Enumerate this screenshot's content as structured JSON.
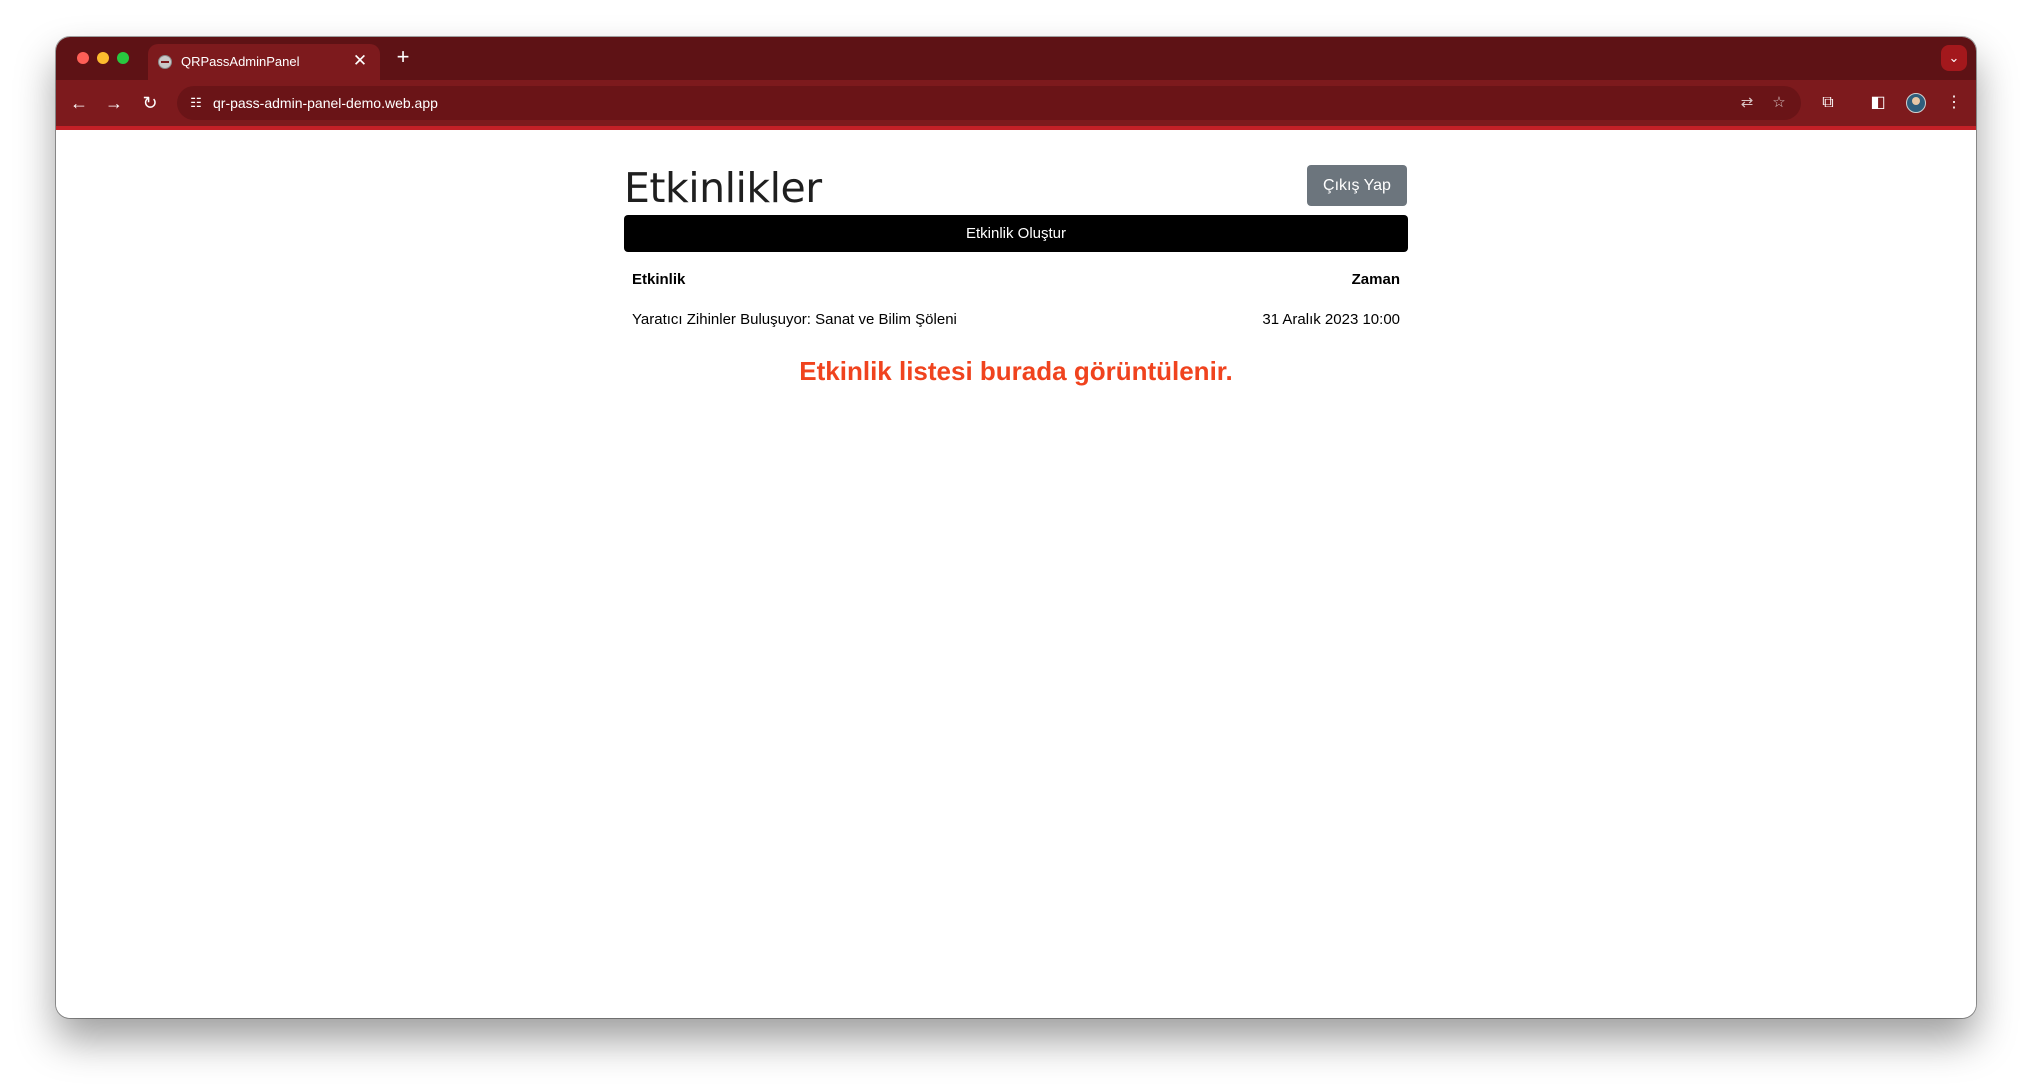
{
  "browser": {
    "tab_title": "QRPassAdminPanel",
    "url": "qr-pass-admin-panel-demo.web.app",
    "accent_color": "#7d1a1d"
  },
  "page": {
    "title": "Etkinlikler",
    "logout_label": "Çıkış Yap",
    "create_label": "Etkinlik Oluştur",
    "columns": [
      "Etkinlik",
      "Zaman"
    ],
    "rows": [
      {
        "event": "Yaratıcı Zihinler Buluşuyor: Sanat ve Bilim Şöleni",
        "time": "31 Aralık 2023 10:00"
      }
    ],
    "annotation": "Etkinlik listesi burada görüntülenir."
  }
}
